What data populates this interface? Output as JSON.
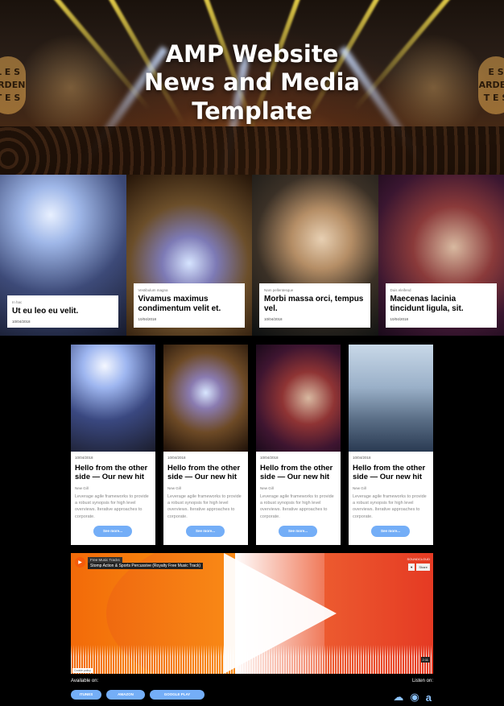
{
  "hero": {
    "title_line1": "AMP Website",
    "title_line2": "News and Media",
    "title_line3": "Template",
    "logo_left": "L E S\nARDEN\nT E S",
    "logo_right": "E S\nARDEN\nT E S"
  },
  "features": [
    {
      "category": "In hac",
      "title": "Ut eu leo eu velit.",
      "date": "10/04/2018"
    },
    {
      "category": "Vestibulum magna",
      "title": "Vivamus maximus condimentum velit et.",
      "date": "10/04/2018"
    },
    {
      "category": "Nam pellentesque",
      "title": "Morbi massa orci, tempus vel.",
      "date": "10/04/2018"
    },
    {
      "category": "Duis eleifend",
      "title": "Maecenas lacinia tincidunt ligula, sit.",
      "date": "10/04/2018"
    }
  ],
  "articles": [
    {
      "date": "10/04/2018",
      "title": "Hello from the other side — Our new hit",
      "author": "New Gill",
      "desc": "Leverage agile frameworks to provide a robust synopsis for high level overviews. Iterative approaches to corporate.",
      "button": "See more..."
    },
    {
      "date": "10/04/2018",
      "title": "Hello from the other side — Our new hit",
      "author": "New Gill",
      "desc": "Leverage agile frameworks to provide a robust synopsis for high level overviews. Iterative approaches to corporate.",
      "button": "See more..."
    },
    {
      "date": "10/04/2018",
      "title": "Hello from the other side — Our new hit",
      "author": "New Gill",
      "desc": "Leverage agile frameworks to provide a robust synopsis for high level overviews. Iterative approaches to corporate.",
      "button": "See more..."
    },
    {
      "date": "10/04/2018",
      "title": "Hello from the other side — Our new hit",
      "author": "New Gill",
      "desc": "Leverage agile frameworks to provide a robust synopsis for high level overviews. Iterative approaches to corporate.",
      "button": "See more..."
    }
  ],
  "player": {
    "artist": "Free Music Tracks",
    "track": "Stomp Action & Sports Percussive (Royalty Free Music Track)",
    "provider": "SOUNDCLOUD",
    "like_label": "♥",
    "share_label": "Share",
    "cookie": "Cookie policy",
    "time": "2:11"
  },
  "footer": {
    "available_label": "Available on:",
    "listen_label": "Listen on:",
    "stores": [
      "ITUNES",
      "AMAZON",
      "GOOGLE PLAY"
    ],
    "services": [
      "soundcloud-icon",
      "spotify-icon",
      "amazon-icon"
    ]
  },
  "colors": {
    "accent": "#74aef7",
    "player_orange": "#f26a0a",
    "player_red": "#e53a23"
  }
}
